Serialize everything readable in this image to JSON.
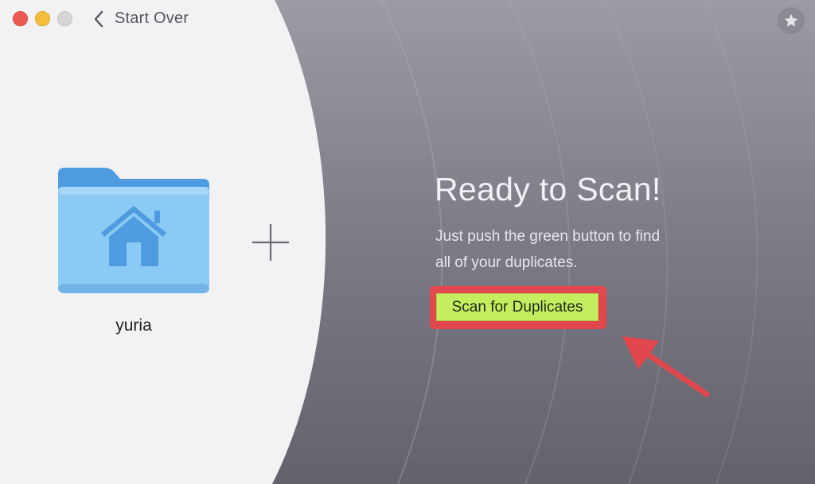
{
  "window": {
    "back_label": "Start Over"
  },
  "left_panel": {
    "folder_name": "yuria"
  },
  "right_panel": {
    "headline": "Ready to Scan!",
    "subtext_line1": "Just push the green button to find",
    "subtext_line2": "all of your duplicates.",
    "scan_button_label": "Scan for Duplicates"
  },
  "icons": [
    "close-icon",
    "minimize-icon",
    "zoom-icon",
    "chevron-left-icon",
    "star-icon",
    "home-folder-icon",
    "plus-icon",
    "arrow-annotation"
  ],
  "colors": {
    "scan_button": "#c6ec5f",
    "highlight": "#e2474d",
    "folder": "#8ccaf6"
  }
}
